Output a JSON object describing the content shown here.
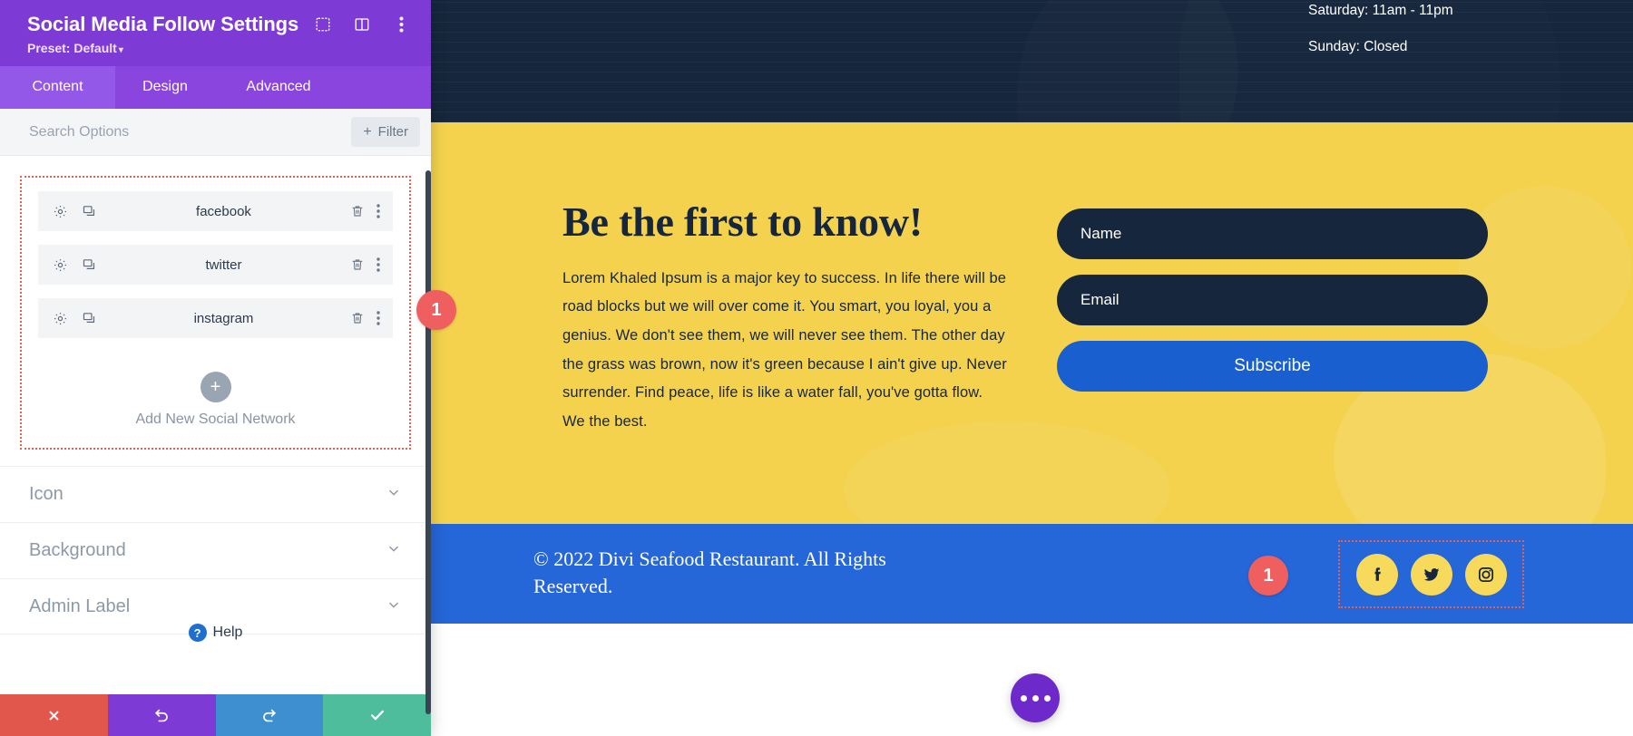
{
  "site": {
    "header": {
      "hours": [
        "Saturday: 11am - 11pm",
        "Sunday: Closed"
      ]
    },
    "promo": {
      "title": "Be the first to know!",
      "body": "Lorem Khaled Ipsum is a major key to success. In life there will be road blocks but we will over come it. You smart, you loyal, you a genius. We don't see them, we will never see them. The other day the grass was brown, now it's green because I ain't give up. Never surrender. Find peace, life is like a water fall, you've gotta flow. We the best.",
      "form": {
        "name_placeholder": "Name",
        "email_placeholder": "Email",
        "name_value": "",
        "email_value": "",
        "submit_label": "Subscribe"
      }
    },
    "footer": {
      "copyright": "© 2022 Divi Seafood Restaurant. All Rights Reserved.",
      "social": [
        {
          "network": "facebook",
          "icon": "facebook-icon"
        },
        {
          "network": "twitter",
          "icon": "twitter-icon"
        },
        {
          "network": "instagram",
          "icon": "instagram-icon"
        }
      ]
    },
    "fab": {
      "icon": "ellipsis-icon"
    },
    "markers": [
      {
        "label": "1"
      },
      {
        "label": "1"
      }
    ],
    "colors": {
      "header_bg": "#16263c",
      "promo_bg": "#f4d24e",
      "footer_bg": "#2566d8",
      "accent_blue": "#1a5fd0",
      "social_bubble": "#f7d95c",
      "highlight_outline": "#e8604c",
      "marker_bg": "#ef5f5f"
    }
  },
  "panel": {
    "title": "Social Media Follow Settings",
    "preset": "Preset: Default",
    "head_icons": [
      {
        "name": "focus-icon"
      },
      {
        "name": "layout-columns-icon"
      },
      {
        "name": "kebab-menu-icon"
      }
    ],
    "tabs": [
      {
        "label": "Content",
        "active": true
      },
      {
        "label": "Design",
        "active": false
      },
      {
        "label": "Advanced",
        "active": false
      }
    ],
    "search": {
      "placeholder": "Search Options",
      "value": "",
      "filter_label": "Filter"
    },
    "networks": [
      {
        "name": "facebook"
      },
      {
        "name": "twitter"
      },
      {
        "name": "instagram"
      }
    ],
    "row_icons": {
      "settings": "gear-icon",
      "duplicate": "duplicate-icon",
      "delete": "trash-icon",
      "more": "kebab-menu-icon"
    },
    "add_new": {
      "plus": "+",
      "label": "Add New Social Network"
    },
    "accordion": [
      {
        "label": "Icon",
        "expanded": false
      },
      {
        "label": "Background",
        "expanded": false
      },
      {
        "label": "Admin Label",
        "expanded": false
      }
    ],
    "help": {
      "label": "Help",
      "badge": "?"
    },
    "footer_buttons": [
      {
        "name": "cancel",
        "icon": "close-icon",
        "color": "#e2574c"
      },
      {
        "name": "undo",
        "icon": "undo-icon",
        "color": "#7e3ad4"
      },
      {
        "name": "redo",
        "icon": "redo-icon",
        "color": "#3e8fd0"
      },
      {
        "name": "save",
        "icon": "check-icon",
        "color": "#4dbd9b"
      }
    ],
    "colors": {
      "header_bg": "#7e3ad4",
      "tabbar_bg": "#8a45de",
      "tab_active_bg": "#9458e8"
    }
  }
}
